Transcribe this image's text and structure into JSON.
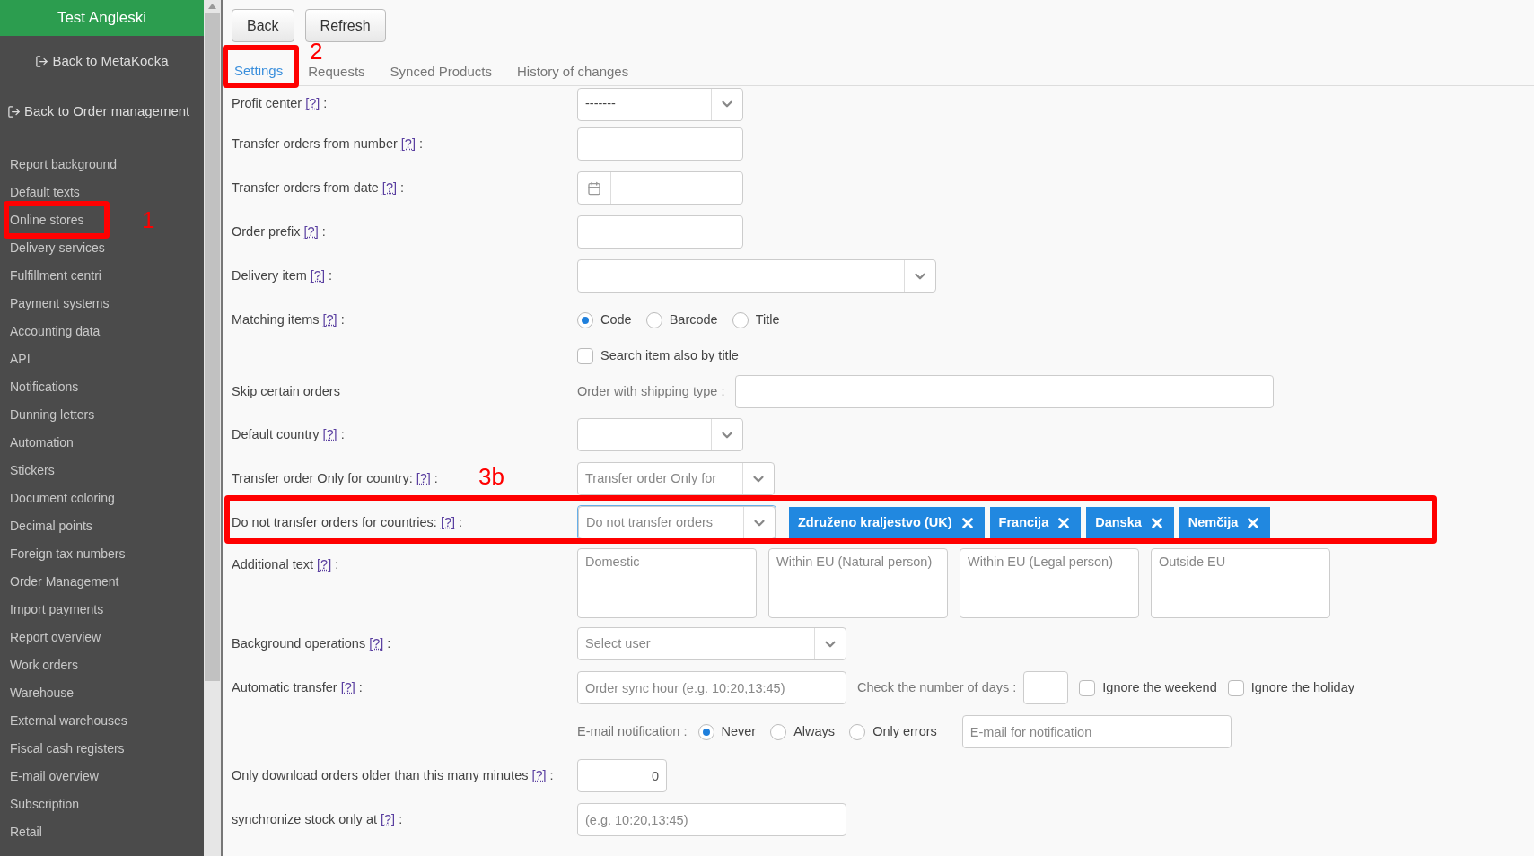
{
  "sidebar": {
    "title": "Test Angleski",
    "back_links": [
      {
        "label": "Back to MetaKocka"
      },
      {
        "label": "Back to Order management"
      }
    ],
    "items": [
      {
        "label": "Report background"
      },
      {
        "label": "Default texts"
      },
      {
        "label": "Online stores"
      },
      {
        "label": "Delivery services"
      },
      {
        "label": "Fulfillment centri"
      },
      {
        "label": "Payment systems"
      },
      {
        "label": "Accounting data"
      },
      {
        "label": "API"
      },
      {
        "label": "Notifications"
      },
      {
        "label": "Dunning letters"
      },
      {
        "label": "Automation"
      },
      {
        "label": "Stickers"
      },
      {
        "label": "Document coloring"
      },
      {
        "label": "Decimal points"
      },
      {
        "label": "Foreign tax numbers"
      },
      {
        "label": "Order Management"
      },
      {
        "label": "Import payments"
      },
      {
        "label": "Report overview"
      },
      {
        "label": "Work orders"
      },
      {
        "label": "Warehouse"
      },
      {
        "label": "External warehouses"
      },
      {
        "label": "Fiscal cash registers"
      },
      {
        "label": "E-mail overview"
      },
      {
        "label": "Subscription"
      },
      {
        "label": "Retail"
      }
    ]
  },
  "toolbar": {
    "buttons": [
      "Back",
      "Refresh"
    ]
  },
  "tabs": [
    {
      "label": "Settings",
      "selected": true
    },
    {
      "label": "Requests",
      "selected": false
    },
    {
      "label": "Synced Products",
      "selected": false
    },
    {
      "label": "History of changes",
      "selected": false
    }
  ],
  "form": {
    "rows": [
      {
        "kind": "select",
        "label": "Profit center",
        "help": "[?]",
        "colon": ":",
        "value": "-------"
      },
      {
        "kind": "text",
        "label": "Transfer orders from number",
        "help": "[?]",
        "colon": ":"
      },
      {
        "kind": "date",
        "label": "Transfer orders from date",
        "help": "[?]",
        "colon": ":"
      },
      {
        "kind": "text",
        "label": "Order prefix",
        "help": "[?]",
        "colon": ":"
      },
      {
        "kind": "select",
        "label": "Delivery item",
        "help": "[?]",
        "colon": ":"
      },
      {
        "kind": "radio",
        "label": "Matching items",
        "help": "[?]",
        "colon": ":",
        "options": [
          {
            "label": "Code",
            "selected": true
          },
          {
            "label": "Barcode",
            "selected": false
          },
          {
            "label": "Title",
            "selected": false
          }
        ]
      },
      {
        "kind": "checkbox",
        "checks": [
          {
            "label": "Search item also by title",
            "checked": false
          }
        ]
      },
      {
        "kind": "skip",
        "label": "Skip certain orders",
        "inline_label": "Order with shipping type :"
      },
      {
        "kind": "select",
        "label": "Default country",
        "help": "[?]",
        "colon": ":"
      },
      {
        "kind": "select",
        "label": "Transfer order Only for country:",
        "help": "[?]",
        "colon": ":",
        "placeholder": "Transfer order Only for"
      },
      {
        "kind": "tags",
        "label": "Do not transfer orders for countries:",
        "help": "[?]",
        "colon": ":",
        "placeholder": "Do not transfer orders",
        "tags": [
          "Združeno kraljestvo (UK)",
          "Francija",
          "Danska",
          "Nemčija"
        ]
      },
      {
        "kind": "textareas",
        "label": "Additional text",
        "help": "[?]",
        "colon": ":",
        "placeholders": [
          "Domestic",
          "Within EU (Natural person)",
          "Within EU (Legal person)",
          "Outside EU"
        ]
      },
      {
        "kind": "select",
        "label": "Background operations",
        "help": "[?]",
        "colon": ":",
        "placeholder": "Select user"
      },
      {
        "kind": "automatic",
        "label": "Automatic transfer",
        "help": "[?]",
        "colon": ":",
        "placeholder": "Order sync hour (e.g. 10:20,13:45)",
        "days_label": "Check the number of days :",
        "checks": [
          {
            "label": "Ignore the weekend",
            "checked": false
          },
          {
            "label": "Ignore the holiday",
            "checked": false
          }
        ]
      },
      {
        "kind": "email",
        "inline_label": "E-mail notification :",
        "options": [
          {
            "label": "Never",
            "selected": true
          },
          {
            "label": "Always",
            "selected": false
          },
          {
            "label": "Only errors",
            "selected": false
          }
        ],
        "placeholder": "E-mail for notification"
      },
      {
        "kind": "number",
        "label": "Only download orders older than this many minutes",
        "help": "[?]",
        "colon": ":",
        "value": "0"
      },
      {
        "kind": "text",
        "label": "synchronize stock only at",
        "help": "[?]",
        "colon": ":",
        "placeholder": "(e.g. 10:20,13:45)"
      }
    ]
  },
  "annotations": [
    {
      "label": "1"
    },
    {
      "label": "2"
    },
    {
      "label": "3b"
    }
  ]
}
